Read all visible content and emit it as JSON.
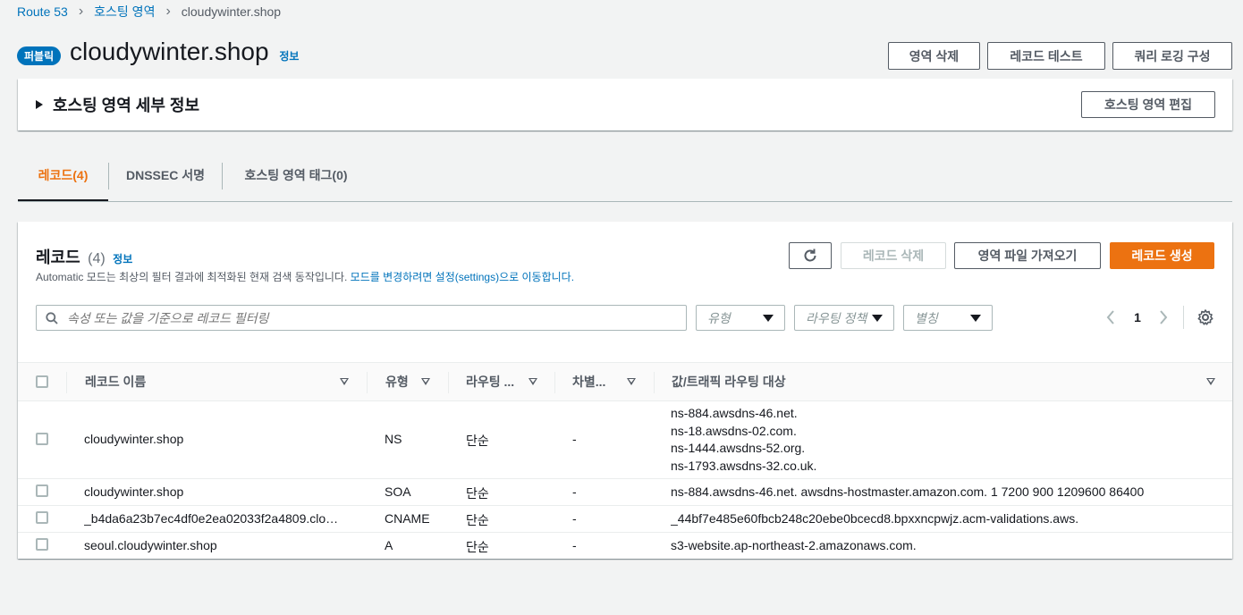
{
  "breadcrumb": {
    "items": [
      "Route 53",
      "호스팅 영역",
      "cloudywinter.shop"
    ]
  },
  "header": {
    "badge": "퍼블릭",
    "title": "cloudywinter.shop",
    "info": "정보",
    "buttons": {
      "delete_zone": "영역 삭제",
      "test_record": "레코드 테스트",
      "query_logging": "쿼리 로깅 구성"
    }
  },
  "details": {
    "title": "호스팅 영역 세부 정보",
    "edit_button": "호스팅 영역 편집"
  },
  "tabs": [
    {
      "label": "레코드(4)",
      "active": true
    },
    {
      "label": "DNSSEC 서명",
      "active": false
    },
    {
      "label": "호스팅 영역 태그(0)",
      "active": false
    }
  ],
  "records_panel": {
    "title": "레코드",
    "count": "(4)",
    "info": "정보",
    "description_prefix": "Automatic 모드는 최상의 필터 결과에 최적화된 현재 검색 동작입니다.",
    "description_link": "모드를 변경하려면 설정(settings)으로 이동합니다.",
    "buttons": {
      "delete": "레코드 삭제",
      "import": "영역 파일 가져오기",
      "create": "레코드 생성"
    },
    "search_placeholder": "속성 또는 값을 기준으로 레코드 필터링",
    "filters": {
      "type": "유형",
      "routing_policy": "라우팅 정책",
      "alias": "별칭"
    },
    "pagination": {
      "page": "1"
    }
  },
  "table": {
    "columns": [
      "레코드 이름",
      "유형",
      "라우팅 ...",
      "차별...",
      "값/트래픽 라우팅 대상"
    ],
    "rows": [
      {
        "name": "cloudywinter.shop",
        "type": "NS",
        "routing": "단순",
        "diff": "-",
        "values": [
          "ns-884.awsdns-46.net.",
          "ns-18.awsdns-02.com.",
          "ns-1444.awsdns-52.org.",
          "ns-1793.awsdns-32.co.uk."
        ]
      },
      {
        "name": "cloudywinter.shop",
        "type": "SOA",
        "routing": "단순",
        "diff": "-",
        "values": [
          "ns-884.awsdns-46.net. awsdns-hostmaster.amazon.com. 1 7200 900 1209600 86400"
        ]
      },
      {
        "name": "_b4da6a23b7ec4df0e2ea02033f2a4809.clo…",
        "type": "CNAME",
        "routing": "단순",
        "diff": "-",
        "values": [
          "_44bf7e485e60fbcb248c20ebe0bcecd8.bpxxncpwjz.acm-validations.aws."
        ]
      },
      {
        "name": "seoul.cloudywinter.shop",
        "type": "A",
        "routing": "단순",
        "diff": "-",
        "values": [
          "s3-website.ap-northeast-2.amazonaws.com."
        ]
      }
    ]
  },
  "colors": {
    "link": "#0073bb",
    "accent": "#ec7211",
    "background": "#f2f3f3"
  }
}
